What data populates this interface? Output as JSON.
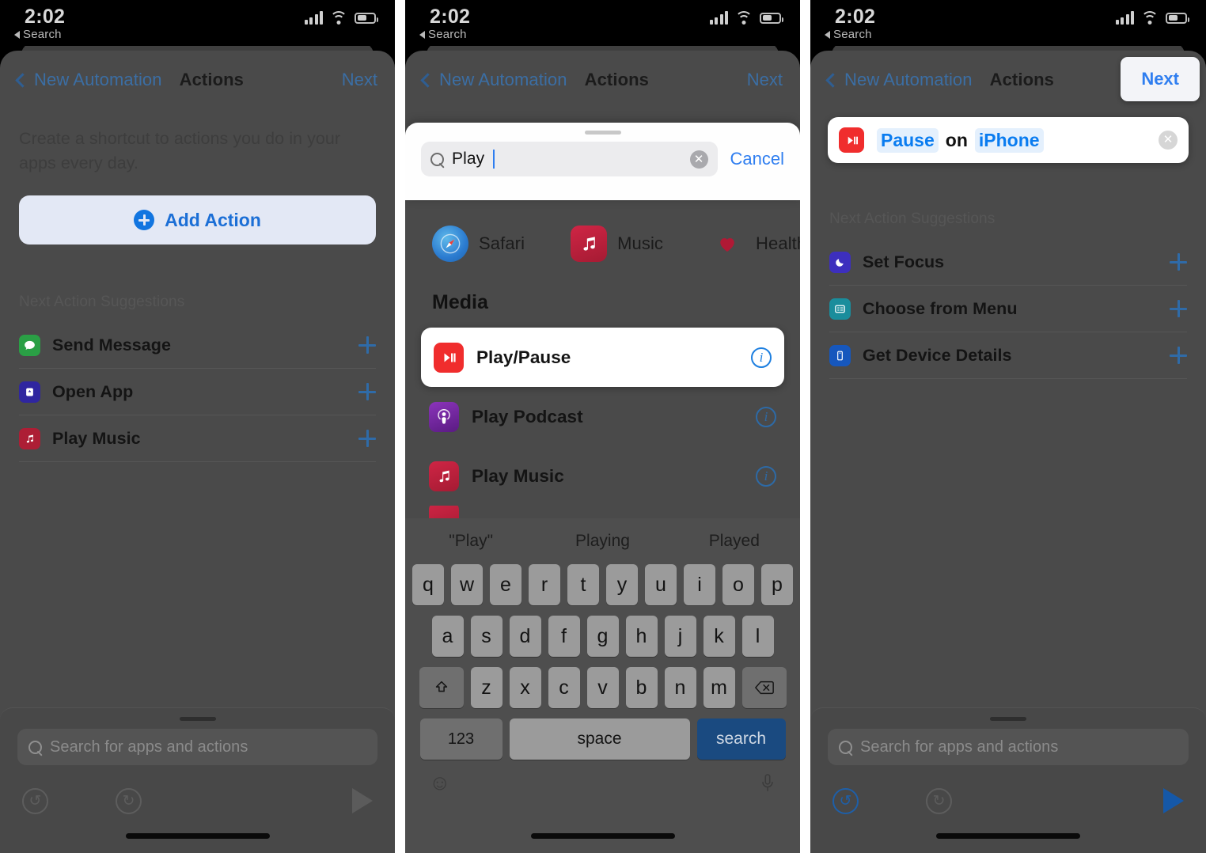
{
  "status_bar": {
    "time": "2:02",
    "back_label": "Search",
    "signal_icon": "cellular-bars-icon",
    "wifi_icon": "wifi-icon",
    "battery_icon": "battery-icon"
  },
  "nav": {
    "back_label": "New Automation",
    "title": "Actions",
    "next_label": "Next"
  },
  "panel1": {
    "intro": "Create a shortcut to actions you do in your apps every day.",
    "add_action_label": "Add Action",
    "suggestions_header": "Next Action Suggestions",
    "suggestions": [
      {
        "label": "Send Message",
        "icon": "messages-app-icon",
        "color": "#30b94d"
      },
      {
        "label": "Open App",
        "icon": "open-app-icon",
        "color": "#3a2fb0"
      },
      {
        "label": "Play Music",
        "icon": "music-app-icon",
        "color": "#c6243c"
      }
    ]
  },
  "panel2": {
    "search": {
      "value": "Play",
      "cancel_label": "Cancel",
      "clear_icon": "clear-circle-icon",
      "search_icon": "search-icon"
    },
    "apps": [
      {
        "name": "Safari",
        "icon": "safari-app-icon",
        "color": "#2f7fd8"
      },
      {
        "name": "Music",
        "icon": "music-app-icon",
        "color": "#b5213a"
      },
      {
        "name": "Health",
        "icon": "health-heart-icon",
        "color": "#b01935"
      }
    ],
    "section_header": "Media",
    "results": [
      {
        "label": "Play/Pause",
        "icon": "play-pause-icon",
        "color": "#f02d2d",
        "selected": true
      },
      {
        "label": "Play Podcast",
        "icon": "podcasts-app-icon",
        "color": "#6b2392",
        "selected": false
      },
      {
        "label": "Play Music",
        "icon": "music-app-icon",
        "color": "#c0223a",
        "selected": false
      }
    ],
    "keyboard": {
      "predictions": [
        "\"Play\"",
        "Playing",
        "Played"
      ],
      "row1": [
        "q",
        "w",
        "e",
        "r",
        "t",
        "y",
        "u",
        "i",
        "o",
        "p"
      ],
      "row2": [
        "a",
        "s",
        "d",
        "f",
        "g",
        "h",
        "j",
        "k",
        "l"
      ],
      "row3": [
        "z",
        "x",
        "c",
        "v",
        "b",
        "n",
        "m"
      ],
      "shift_label": "shift-key",
      "backspace_label": "backspace-key",
      "numbers_label": "123",
      "space_label": "space",
      "return_label": "search",
      "emoji_label": "emoji-key",
      "mic_label": "dictation-key"
    }
  },
  "panel3": {
    "action": {
      "icon": "play-pause-icon",
      "token1": "Pause",
      "connector": "on",
      "token2": "iPhone",
      "remove_icon": "remove-circle-icon"
    },
    "suggestions_header": "Next Action Suggestions",
    "suggestions": [
      {
        "label": "Set Focus",
        "icon": "focus-moon-icon",
        "color": "#4636c8"
      },
      {
        "label": "Choose from Menu",
        "icon": "menu-list-icon",
        "color": "#1e8f9e"
      },
      {
        "label": "Get Device Details",
        "icon": "device-details-icon",
        "color": "#1a5fc4"
      }
    ]
  },
  "dock": {
    "search_placeholder": "Search for apps and actions",
    "undo_icon": "undo-icon",
    "redo_icon": "redo-icon",
    "run_icon": "play-run-icon"
  },
  "colors": {
    "accent_blue": "#0a7cf0",
    "dim_background": "#4a4a4a",
    "sheet_background": "#4a4a4a",
    "keyboard_background": "#4e4e4e",
    "return_key_blue": "#1a4a80"
  }
}
